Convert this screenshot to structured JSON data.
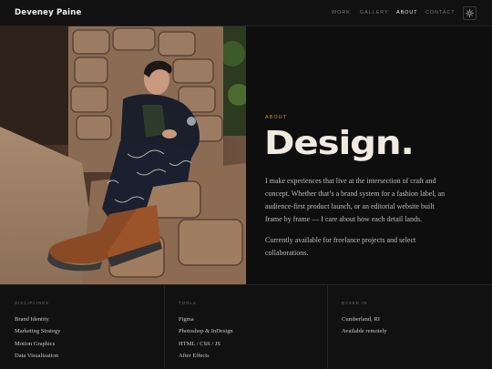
{
  "site": {
    "name": "Deveney Paine"
  },
  "nav": [
    {
      "label": "WORK",
      "active": false
    },
    {
      "label": "GALLERY",
      "active": false
    },
    {
      "label": "ABOUT",
      "active": true
    },
    {
      "label": "CONTACT",
      "active": false
    }
  ],
  "theme_toggle": {
    "icon": "sun-icon"
  },
  "about": {
    "eyebrow": "ABOUT",
    "title": "Design",
    "title_dot": ".",
    "paragraph_1": "I make experiences that live at the intersection of craft and concept. Whether that’s a brand system for a fashion label, an audience-first product launch, or an editorial website built frame by frame — I care about how each detail lands.",
    "paragraph_2": "Currently available for freelance projects and select collaborations."
  },
  "footer": {
    "disciplines": {
      "heading": "DISCIPLINES",
      "items": [
        "Brand Identity",
        "Marketing Strategy",
        "Motion Graphics",
        "Data Visualization"
      ]
    },
    "tools": {
      "heading": "TOOLS",
      "items": [
        "Figma",
        "Photoshop & InDesign",
        "HTML / CSS / JS",
        "After Effects"
      ]
    },
    "based_in": {
      "heading": "BASED IN",
      "items": [
        "Cumberland, RI",
        "Available remotely"
      ]
    }
  },
  "colors": {
    "background": "#0e0e0e",
    "accent": "#c6913f",
    "title": "#f0ebe0"
  }
}
